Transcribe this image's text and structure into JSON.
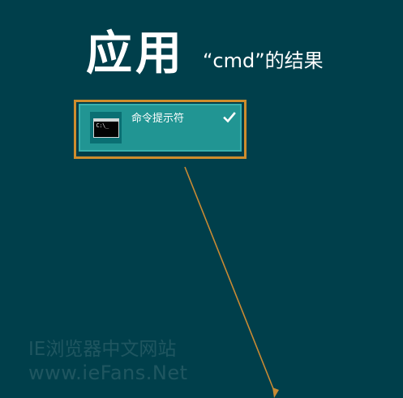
{
  "header": {
    "title": "应用",
    "subtitle": "“cmd”的结果"
  },
  "result": {
    "label": "命令提示符",
    "icon_prompt": "C:\\_",
    "icon": "command-prompt-icon",
    "selected_icon": "check-icon"
  },
  "watermark": {
    "line1": "IE浏览器中文网站",
    "line2": "www.ieFans.Net"
  },
  "colors": {
    "background": "#003f4b",
    "tile": "#219593",
    "highlight": "#cf8d2d",
    "text": "#ffffff"
  }
}
